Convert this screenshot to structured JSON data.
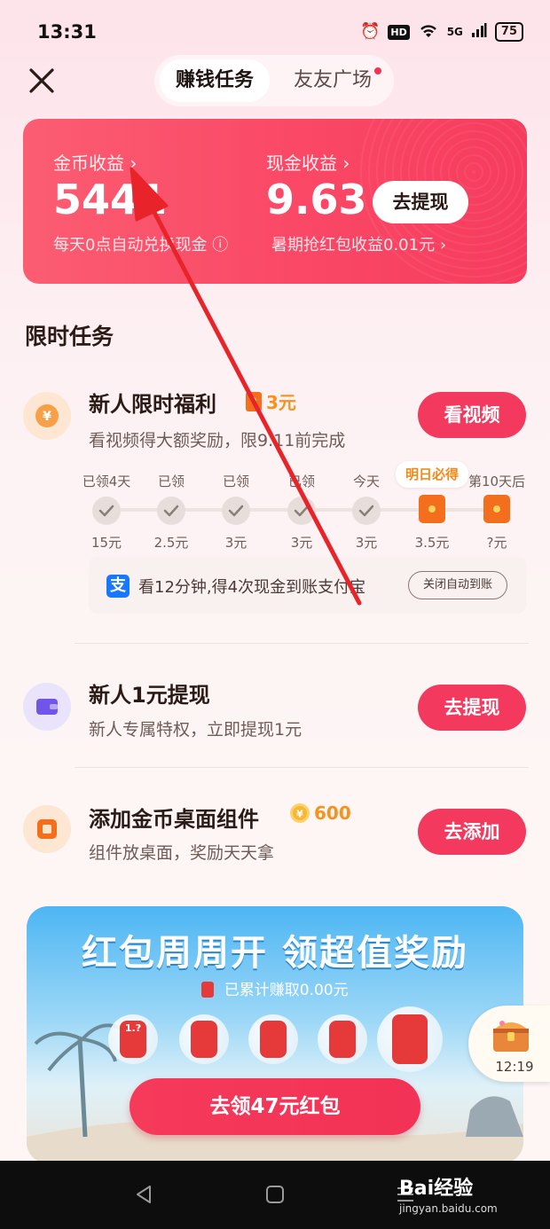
{
  "status_bar": {
    "time": "13:31",
    "hd": "HD",
    "network": "5G",
    "battery": "75"
  },
  "tabs": [
    {
      "label": "赚钱任务"
    },
    {
      "label": "友友广场"
    }
  ],
  "earnings": {
    "coins_label": "金币收益",
    "coins_value": "5441",
    "coins_note": "每天0点自动兑换现金",
    "cash_label": "现金收益",
    "cash_value": "9.63",
    "cash_note": "暑期抢红包收益0.01元",
    "withdraw_label": "去提现"
  },
  "section_title": "限时任务",
  "task1": {
    "title": "新人限时福利",
    "reward": "3元",
    "desc": "看视频得大额奖励，限9.11前完成",
    "button": "看视频",
    "tomorrow_tip": "明日必得",
    "days": [
      {
        "label": "已领4天",
        "amount": "15元",
        "state": "done"
      },
      {
        "label": "已领",
        "amount": "2.5元",
        "state": "done"
      },
      {
        "label": "已领",
        "amount": "3元",
        "state": "done"
      },
      {
        "label": "已领",
        "amount": "3元",
        "state": "done"
      },
      {
        "label": "今天",
        "amount": "3元",
        "state": "done"
      },
      {
        "label": "",
        "amount": "3.5元",
        "state": "redpacket"
      },
      {
        "label": "第10天后",
        "amount": "?元",
        "state": "redpacket"
      }
    ],
    "alipay_text": "看12分钟,得4次现金到账支付宝",
    "auto_button": "关闭自动到账"
  },
  "task2": {
    "title": "新人1元提现",
    "desc": "新人专属特权，立即提现1元",
    "button": "去提现"
  },
  "task3": {
    "title": "添加金币桌面组件",
    "reward": "600",
    "desc": "组件放桌面，奖励天天拿",
    "button": "去添加"
  },
  "banner": {
    "title": "红包周周开 领超值奖励",
    "subtitle": "已累计赚取0.00元",
    "bubble_mark": "1.?",
    "cta": "去领47元红包"
  },
  "chest_widget": {
    "time": "12:19"
  },
  "watermark": {
    "brand": "Bai经验",
    "url": "jingyan.baidu.com"
  },
  "colors": {
    "accent_red": "#f33a5e",
    "card_red": "#fa4866",
    "gold": "#f7921e",
    "arrow": "#e8232a"
  }
}
